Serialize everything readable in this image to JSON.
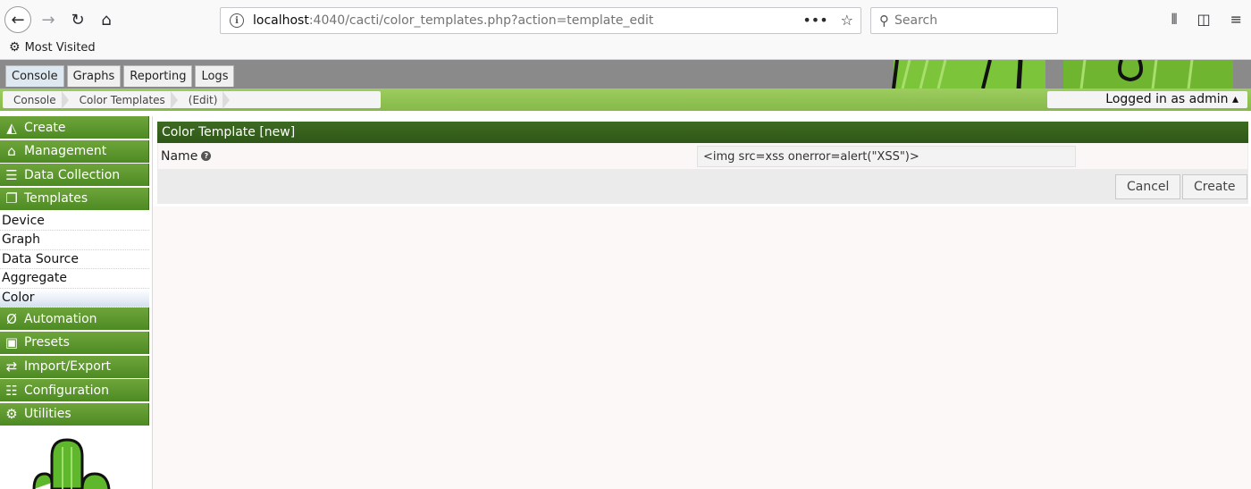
{
  "browser": {
    "url_host": "localhost",
    "url_path": ":4040/cacti/color_templates.php?action=template_edit",
    "search_placeholder": "Search",
    "bookmark": "Most Visited"
  },
  "header": {
    "tabs": [
      {
        "label": "Console",
        "active": true
      },
      {
        "label": "Graphs"
      },
      {
        "label": "Reporting"
      },
      {
        "label": "Logs"
      }
    ],
    "breadcrumbs": [
      "Console",
      "Color Templates",
      "(Edit)"
    ],
    "logged_in": "Logged in as admin ▴"
  },
  "sidebar": {
    "sections": [
      {
        "label": "Create",
        "icon": "chart-icon"
      },
      {
        "label": "Management",
        "icon": "home-icon"
      },
      {
        "label": "Data Collection",
        "icon": "database-icon"
      },
      {
        "label": "Templates",
        "icon": "copy-icon"
      }
    ],
    "template_items": [
      "Device",
      "Graph",
      "Data Source",
      "Aggregate",
      "Color"
    ],
    "lower_sections": [
      {
        "label": "Automation",
        "icon": "automation-icon"
      },
      {
        "label": "Presets",
        "icon": "presets-icon"
      },
      {
        "label": "Import/Export",
        "icon": "import-export-icon"
      },
      {
        "label": "Configuration",
        "icon": "sliders-icon"
      },
      {
        "label": "Utilities",
        "icon": "gears-icon"
      }
    ]
  },
  "main": {
    "panel_title": "Color Template [new]",
    "name_label": "Name",
    "name_value": "<img src=xss onerror=alert(\"XSS\")>",
    "cancel_label": "Cancel",
    "create_label": "Create"
  },
  "colors": {
    "sidebar_green": "#4d8a23",
    "panel_green": "#2f5717",
    "crumb_green": "#86b84a"
  }
}
